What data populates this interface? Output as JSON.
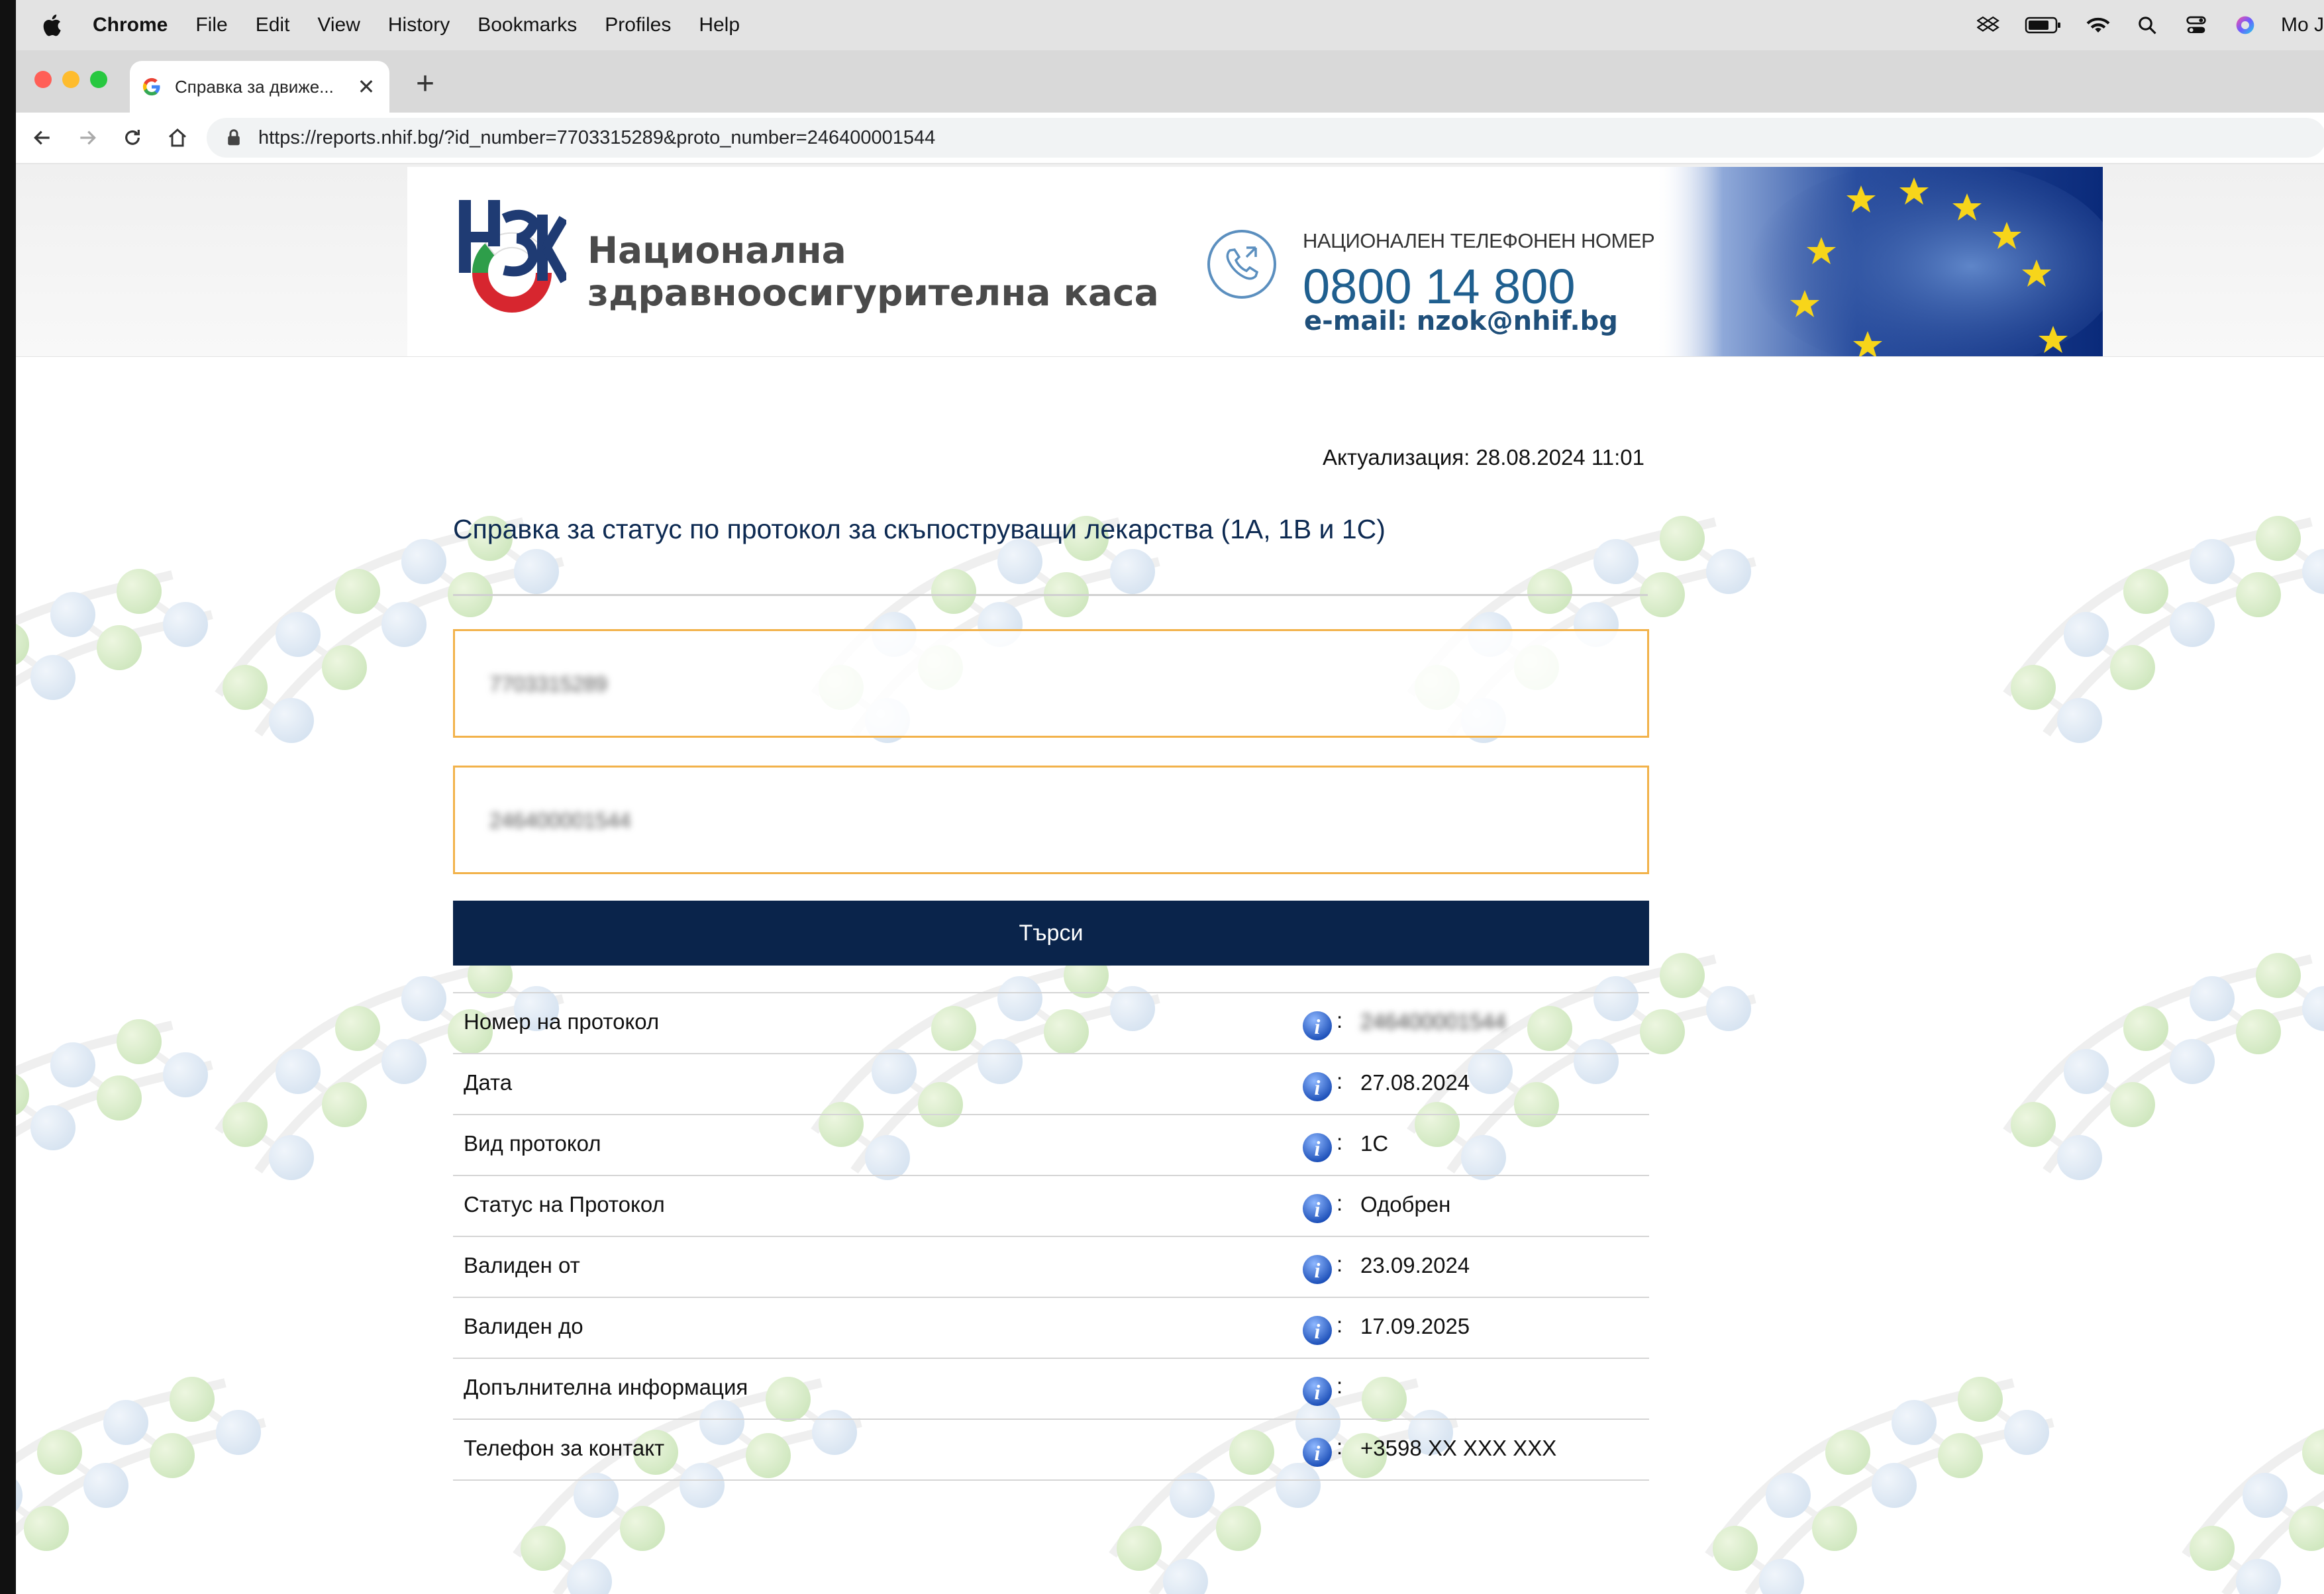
{
  "menubar": {
    "app": "Chrome",
    "items": [
      "File",
      "Edit",
      "View",
      "History",
      "Bookmarks",
      "Profiles",
      "Help"
    ],
    "user": "Mo J"
  },
  "browser": {
    "tab_title": "Справка за движе...",
    "url": "https://reports.nhif.bg/?id_number=7703315289&proto_number=246400001544"
  },
  "header": {
    "org_line1": "Национална",
    "org_line2": "здравноосигурителна каса",
    "phone_label": "НАЦИОНАЛЕН ТЕЛЕФОНЕН НОМЕР",
    "phone_number": "0800 14 800",
    "email": "e-mail: nzok@nhif.bg"
  },
  "content": {
    "updated": "Актуализация: 28.08.2024 11:01",
    "title": "Справка за статус по протокол за скъпоструващи лекарства (1A, 1B и 1C)",
    "id_field_value": "7703315289",
    "proto_field_value": "246400001544",
    "search_label": "Търси"
  },
  "results": [
    {
      "label": "Номер на протокол",
      "value": "246400001544",
      "blurred": true
    },
    {
      "label": "Дата",
      "value": "27.08.2024"
    },
    {
      "label": "Вид протокол",
      "value": "1C"
    },
    {
      "label": "Статус на Протокол",
      "value": "Одобрен"
    },
    {
      "label": "Валиден от",
      "value": "23.09.2024"
    },
    {
      "label": "Валиден до",
      "value": "17.09.2025"
    },
    {
      "label": "Допълнителна информация",
      "value": ""
    },
    {
      "label": "Телефон за контакт",
      "value": "+3598 XX XXX XXX"
    }
  ],
  "colors": {
    "menubar_bg": "#e3e3e3",
    "search_button": "#0a244b",
    "field_border": "#f2b24a",
    "title_text": "#0d2a52",
    "phone_text": "#1f5f8f"
  },
  "icons": [
    "apple-icon",
    "dropbox-icon",
    "battery-icon",
    "wifi-icon",
    "search-icon",
    "control-center-icon",
    "siri-icon",
    "google-favicon",
    "close-icon",
    "plus-icon",
    "back-icon",
    "forward-icon",
    "reload-icon",
    "home-icon",
    "lock-icon",
    "phone-icon",
    "info-icon"
  ]
}
